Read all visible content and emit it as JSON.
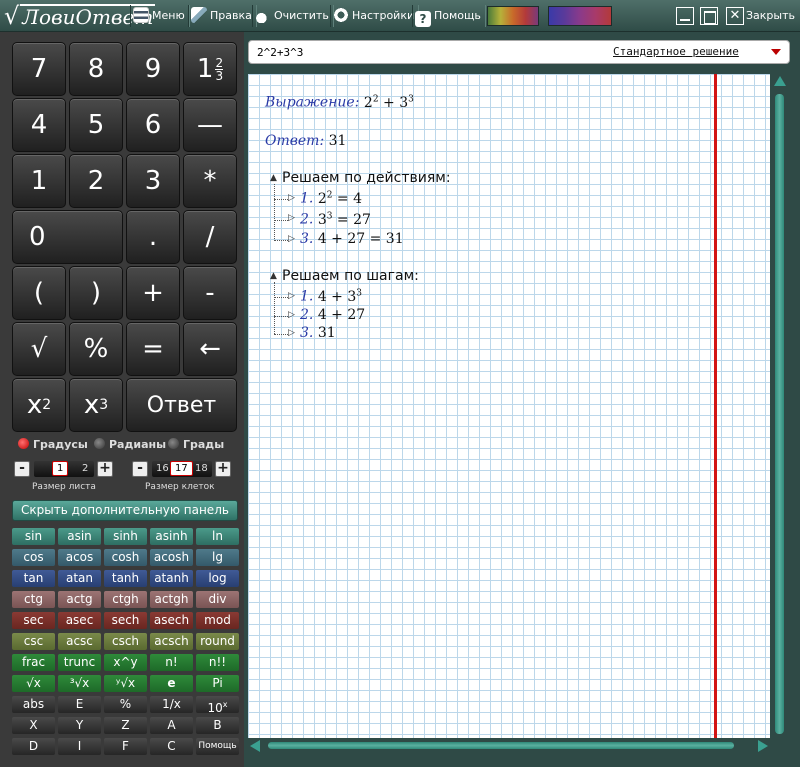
{
  "app": {
    "logo_text": "ЛовиОтвет",
    "logo_symbol": "√"
  },
  "toolbar": {
    "menu": "Меню",
    "edit": "Правка",
    "clear": "Очистить",
    "settings": "Настройки",
    "help": "Помощь",
    "close": "Закрыть",
    "close_symbol": "✕",
    "help_symbol": "?"
  },
  "keypad": {
    "k7": "7",
    "k8": "8",
    "k9": "9",
    "mixed_whole": "1",
    "mixed_num": "2",
    "mixed_den": "3",
    "k4": "4",
    "k5": "5",
    "k6": "6",
    "frac_bar": "—",
    "k1": "1",
    "k2": "2",
    "k3": "3",
    "mul": "*",
    "k0": "0",
    "dot": ".",
    "div": "/",
    "lparen": "(",
    "rparen": ")",
    "plus": "+",
    "minus": "-",
    "sqrt": "√",
    "percent": "%",
    "equals": "=",
    "backspace": "←",
    "x2_base": "x",
    "x2_exp": "2",
    "x3_base": "x",
    "x3_exp": "3",
    "answer": "Ответ"
  },
  "angle_modes": {
    "degrees": "Градусы",
    "radians": "Радианы",
    "grads": "Грады",
    "selected": "degrees"
  },
  "sheet_size": {
    "label": "Размер листа",
    "value": "1",
    "next": "2",
    "minus": "-",
    "plus": "+"
  },
  "cell_size": {
    "label": "Размер клеток",
    "prev": "16",
    "value": "17",
    "next": "18",
    "minus": "-",
    "plus": "+"
  },
  "hide_panel_label": "Скрыть дополнительную панель",
  "functions": {
    "r1": [
      "sin",
      "asin",
      "sinh",
      "asinh",
      "ln"
    ],
    "r2": [
      "cos",
      "acos",
      "cosh",
      "acosh",
      "lg"
    ],
    "r3": [
      "tan",
      "atan",
      "tanh",
      "atanh",
      "log"
    ],
    "r4": [
      "ctg",
      "actg",
      "ctgh",
      "actgh",
      "div"
    ],
    "r5": [
      "sec",
      "asec",
      "sech",
      "asech",
      "mod"
    ],
    "r6": [
      "csc",
      "acsc",
      "csch",
      "acsch",
      "round"
    ],
    "r7": [
      "frac",
      "trunc",
      "x^y",
      "n!",
      "n!!"
    ],
    "r8": [
      "√x",
      "³√x",
      "ʸ√x",
      "e",
      "Pi"
    ],
    "r9": [
      "abs",
      "E",
      "%",
      "1/x",
      "10"
    ],
    "r9_sup": "x",
    "r10": [
      "X",
      "Y",
      "Z",
      "A",
      "B"
    ],
    "r11": [
      "D",
      "I",
      "F",
      "C",
      "Помощь"
    ]
  },
  "input": {
    "expression": "2^2+3^3",
    "solution_mode": "Стандартное решение"
  },
  "result": {
    "expression_label": "Выражение:",
    "answer_label": "Ответ:",
    "answer_value": "31",
    "by_actions_title": "Решаем по действиям:",
    "by_steps_title": "Решаем по шагам:",
    "steps_num": [
      "1.",
      "2.",
      "3."
    ],
    "action1": {
      "b": "2",
      "e": "2",
      "rest": "= 4"
    },
    "action2": {
      "b": "3",
      "e": "3",
      "rest": "= 27"
    },
    "action3": "4 + 27 = 31",
    "step1_pre": "4 + 3",
    "step1_exp": "3",
    "step2": "4 + 27",
    "step3": "31"
  },
  "colors": {
    "margin_line": "#d21414",
    "label_blue": "#2a3aa6",
    "accent_teal": "#3aa090"
  }
}
